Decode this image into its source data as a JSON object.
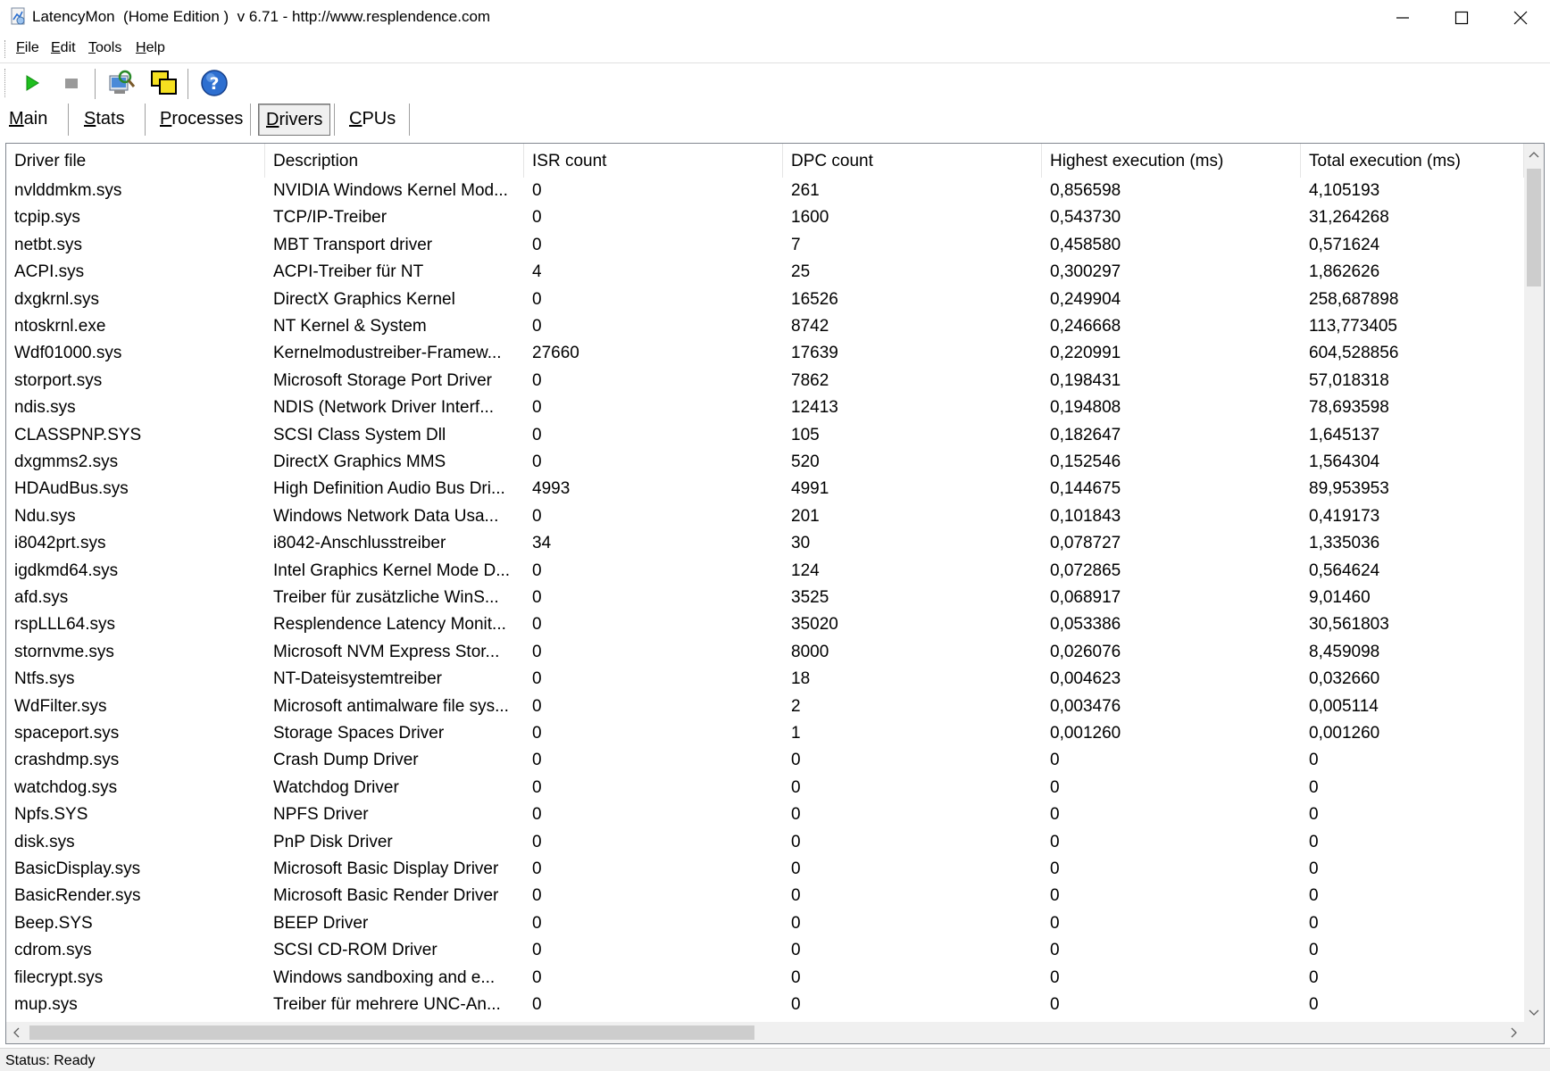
{
  "window": {
    "title": "LatencyMon  (Home Edition )  v 6.71 - http://www.resplendence.com"
  },
  "menu": {
    "items": [
      {
        "label": "File"
      },
      {
        "label": "Edit"
      },
      {
        "label": "Tools"
      },
      {
        "label": "Help"
      }
    ]
  },
  "toolbar": {
    "buttons": [
      {
        "icon": "play-icon"
      },
      {
        "icon": "stop-icon"
      },
      {
        "icon": "system-info-icon"
      },
      {
        "icon": "windows-icon"
      },
      {
        "icon": "help-icon"
      }
    ]
  },
  "tabs": [
    {
      "label": "Main"
    },
    {
      "label": "Stats"
    },
    {
      "label": "Processes"
    },
    {
      "label": "Drivers",
      "active": true
    },
    {
      "label": "CPUs"
    }
  ],
  "table": {
    "columns": [
      "Driver file",
      "Description",
      "ISR count",
      "DPC count",
      "Highest execution (ms)",
      "Total execution (ms)"
    ],
    "rows": [
      [
        "nvlddmkm.sys",
        "NVIDIA Windows Kernel Mod...",
        "0",
        "261",
        "0,856598",
        "4,105193"
      ],
      [
        "tcpip.sys",
        "TCP/IP-Treiber",
        "0",
        "1600",
        "0,543730",
        "31,264268"
      ],
      [
        "netbt.sys",
        "MBT Transport driver",
        "0",
        "7",
        "0,458580",
        "0,571624"
      ],
      [
        "ACPI.sys",
        "ACPI-Treiber für NT",
        "4",
        "25",
        "0,300297",
        "1,862626"
      ],
      [
        "dxgkrnl.sys",
        "DirectX Graphics Kernel",
        "0",
        "16526",
        "0,249904",
        "258,687898"
      ],
      [
        "ntoskrnl.exe",
        "NT Kernel & System",
        "0",
        "8742",
        "0,246668",
        "113,773405"
      ],
      [
        "Wdf01000.sys",
        "Kernelmodustreiber-Framew...",
        "27660",
        "17639",
        "0,220991",
        "604,528856"
      ],
      [
        "storport.sys",
        "Microsoft Storage Port Driver",
        "0",
        "7862",
        "0,198431",
        "57,018318"
      ],
      [
        "ndis.sys",
        "NDIS (Network Driver Interf...",
        "0",
        "12413",
        "0,194808",
        "78,693598"
      ],
      [
        "CLASSPNP.SYS",
        "SCSI Class System Dll",
        "0",
        "105",
        "0,182647",
        "1,645137"
      ],
      [
        "dxgmms2.sys",
        "DirectX Graphics MMS",
        "0",
        "520",
        "0,152546",
        "1,564304"
      ],
      [
        "HDAudBus.sys",
        "High Definition Audio Bus Dri...",
        "4993",
        "4991",
        "0,144675",
        "89,953953"
      ],
      [
        "Ndu.sys",
        "Windows Network Data Usa...",
        "0",
        "201",
        "0,101843",
        "0,419173"
      ],
      [
        "i8042prt.sys",
        "i8042-Anschlusstreiber",
        "34",
        "30",
        "0,078727",
        "1,335036"
      ],
      [
        "igdkmd64.sys",
        "Intel Graphics Kernel Mode D...",
        "0",
        "124",
        "0,072865",
        "0,564624"
      ],
      [
        "afd.sys",
        "Treiber für zusätzliche WinS...",
        "0",
        "3525",
        "0,068917",
        "9,01460"
      ],
      [
        "rspLLL64.sys",
        "Resplendence Latency Monit...",
        "0",
        "35020",
        "0,053386",
        "30,561803"
      ],
      [
        "stornvme.sys",
        "Microsoft NVM Express Stor...",
        "0",
        "8000",
        "0,026076",
        "8,459098"
      ],
      [
        "Ntfs.sys",
        "NT-Dateisystemtreiber",
        "0",
        "18",
        "0,004623",
        "0,032660"
      ],
      [
        "WdFilter.sys",
        "Microsoft antimalware file sys...",
        "0",
        "2",
        "0,003476",
        "0,005114"
      ],
      [
        "spaceport.sys",
        "Storage Spaces Driver",
        "0",
        "1",
        "0,001260",
        "0,001260"
      ],
      [
        "crashdmp.sys",
        "Crash Dump Driver",
        "0",
        "0",
        "0",
        "0"
      ],
      [
        "watchdog.sys",
        "Watchdog Driver",
        "0",
        "0",
        "0",
        "0"
      ],
      [
        "Npfs.SYS",
        "NPFS Driver",
        "0",
        "0",
        "0",
        "0"
      ],
      [
        "disk.sys",
        "PnP Disk Driver",
        "0",
        "0",
        "0",
        "0"
      ],
      [
        "BasicDisplay.sys",
        "Microsoft Basic Display Driver",
        "0",
        "0",
        "0",
        "0"
      ],
      [
        "BasicRender.sys",
        "Microsoft Basic Render Driver",
        "0",
        "0",
        "0",
        "0"
      ],
      [
        "Beep.SYS",
        "BEEP Driver",
        "0",
        "0",
        "0",
        "0"
      ],
      [
        "cdrom.sys",
        "SCSI CD-ROM Driver",
        "0",
        "0",
        "0",
        "0"
      ],
      [
        "filecrypt.sys",
        "Windows sandboxing and e...",
        "0",
        "0",
        "0",
        "0"
      ],
      [
        "mup.sys",
        "Treiber für mehrere UNC-An...",
        "0",
        "0",
        "0",
        "0"
      ]
    ]
  },
  "status": {
    "text": "Status: Ready"
  }
}
